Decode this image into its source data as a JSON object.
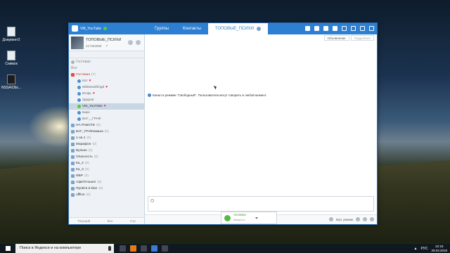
{
  "desktop": {
    "icons": [
      {
        "label": "Документ2",
        "icon": "document-icon"
      },
      {
        "label": "Снимок",
        "icon": "screenshot-icon"
      },
      {
        "label": "NSSA\\Obc...",
        "icon": "app-icon"
      }
    ]
  },
  "window": {
    "user": "VM_YouTube",
    "tabs": [
      {
        "label": "Группы"
      },
      {
        "label": "Контакты"
      },
      {
        "label": "ТОПОВЫЕ_ПСИХИ"
      }
    ],
    "title_icons": [
      "gift-icon",
      "gamepad-icon",
      "bell-icon",
      "people-icon",
      "menu-icon",
      "minimize-icon",
      "maximize-icon",
      "close-icon"
    ]
  },
  "sidebar": {
    "room_name": "ТОПОВЫЕ_ПСИХИ",
    "room_id": "217363598",
    "room_count": "7",
    "search_placeholder": "Все",
    "guest_header": "Гостевая",
    "red_group": {
      "label": "Гостевая",
      "count": "(7)"
    },
    "users_guest": [
      {
        "label": "Кот"
      },
      {
        "label": "Whitewolfchgd"
      },
      {
        "label": "Игорь"
      },
      {
        "label": "Здоров"
      },
      {
        "label": "VM_YouTube"
      },
      {
        "label": "Барс"
      },
      {
        "label": "БАГ__ГРАФ"
      }
    ],
    "groups": [
      {
        "label": "НА РАБОТЕ",
        "count": "(0)"
      },
      {
        "label": "БАГ_ГРАФомаша",
        "count": "(0)"
      },
      {
        "label": "1 на 1",
        "count": "(0)"
      },
      {
        "label": "Марафон",
        "count": "(0)"
      },
      {
        "label": "Вулкан",
        "count": "(0)"
      },
      {
        "label": "Опасность",
        "count": "(0)"
      },
      {
        "label": "Ка_2",
        "count": "(0)"
      },
      {
        "label": "Ка_3",
        "count": "(0)"
      },
      {
        "label": "ФБР",
        "count": "(0)"
      },
      {
        "label": "Афк/Отошел",
        "count": "(0)"
      },
      {
        "label": "Пройти в klan",
        "count": "(0)"
      },
      {
        "label": "offline",
        "count": "(0)"
      }
    ],
    "footer": [
      "Текущий",
      "Все",
      "Стр"
    ]
  },
  "main": {
    "buttons": [
      {
        "label": "Объявление"
      },
      {
        "label": "Подробнее"
      }
    ],
    "system_message": "Канал в режиме \"Свободный\". Пользователи могут говорить в любой момент.",
    "speak_status": "Активен",
    "speak_sub": "Введено...",
    "mode_label": "Муз. режим"
  },
  "taskbar": {
    "search_text": "Поиск в Яндексе и на компьютере",
    "lang": "РУС",
    "time": "22:18",
    "date": "29.03.2018"
  }
}
